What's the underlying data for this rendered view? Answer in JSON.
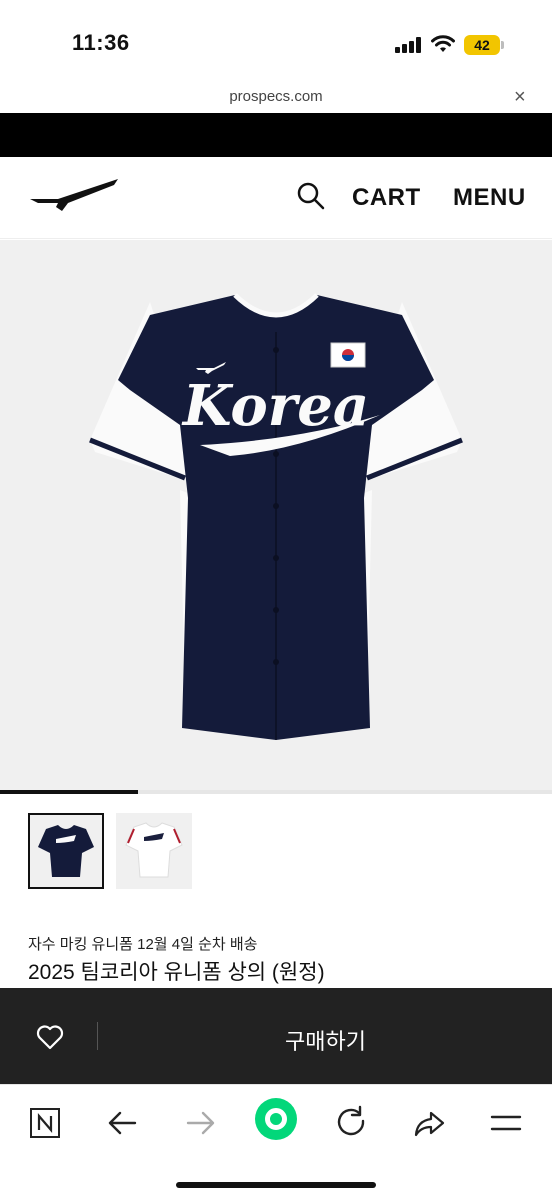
{
  "status_bar": {
    "time": "11:36",
    "battery": "42",
    "battery_color": "#f2c500"
  },
  "browser": {
    "url": "prospecs.com",
    "close_glyph": "×"
  },
  "header": {
    "logo_icon": "prospecs-logo-icon",
    "search_icon": "search-icon",
    "cart_label": "CART",
    "menu_label": "MENU"
  },
  "product": {
    "image_icon": "jersey-image",
    "jersey_text": "Korea",
    "jersey_color": "#141b3a",
    "gallery_progress": 0.25,
    "thumbnails": [
      {
        "name": "navy-jersey-thumbnail",
        "selected": true
      },
      {
        "name": "white-jersey-thumbnail",
        "selected": false
      }
    ],
    "promo_text": "자수 마킹 유니폼 12월 4일 순차 배송",
    "title": "2025 팀코리아 유니폼 상의 (원정)"
  },
  "purchase_bar": {
    "wishlist_icon": "heart-icon",
    "buy_label": "구매하기",
    "background": "#222222"
  },
  "toolbar": {
    "icons": [
      "naver-n-icon",
      "back-arrow-icon",
      "forward-arrow-icon",
      "home-green-icon",
      "reload-icon",
      "share-icon",
      "menu-lines-icon"
    ],
    "green_accent": "#03d77a"
  }
}
